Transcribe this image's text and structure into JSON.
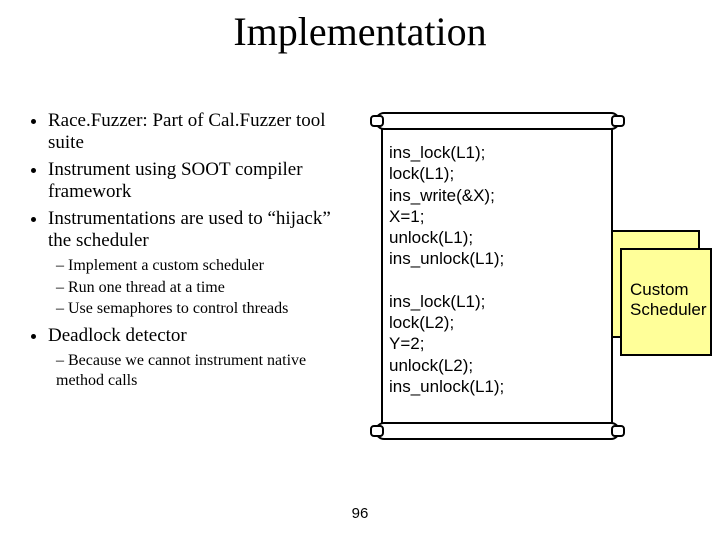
{
  "title": "Implementation",
  "bullets": {
    "b1a": "Race.Fuzzer: Part of Cal.Fuzzer tool suite",
    "b1b": "Instrument using SOOT compiler framework",
    "b1c": "Instrumentations are used to “hijack” the scheduler",
    "b2a": "Implement a custom scheduler",
    "b2b": "Run one thread at a time",
    "b2c": "Use semaphores to control threads",
    "b1d": "Deadlock detector",
    "b2d": "Because we cannot instrument native method calls"
  },
  "code": "ins_lock(L1);\nlock(L1);\nins_write(&X);\nX=1;\nunlock(L1);\nins_unlock(L1);\n\nins_lock(L1);\nlock(L2);\nY=2;\nunlock(L2);\nins_unlock(L1);",
  "scheduler": {
    "line1": "Custom",
    "line2": "Scheduler"
  },
  "pagenum": "96"
}
